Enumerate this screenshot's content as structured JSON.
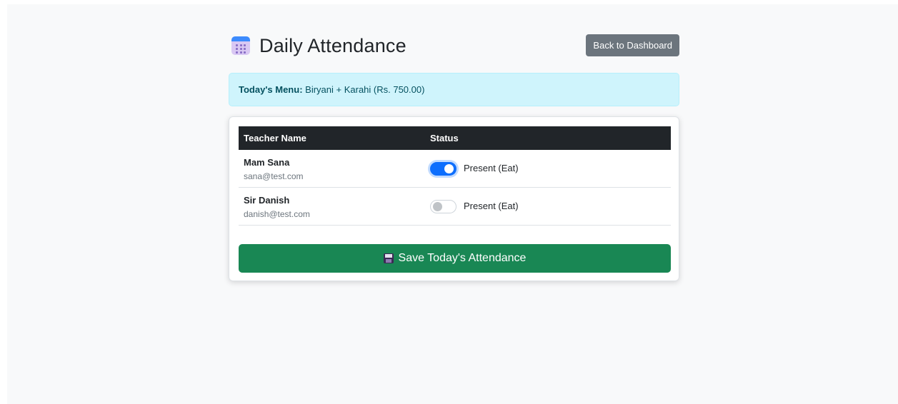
{
  "page": {
    "title": "Daily Attendance",
    "title_icon": "calendar-icon"
  },
  "header": {
    "back_label": "Back to Dashboard"
  },
  "menu": {
    "label": "Today's Menu:",
    "value": "Biryani + Karahi (Rs. 750.00)"
  },
  "table": {
    "headers": [
      "Teacher Name",
      "Status"
    ],
    "rows": [
      {
        "name": "Mam Sana",
        "email": "sana@test.com",
        "status_label": "Present (Eat)",
        "present": true
      },
      {
        "name": "Sir Danish",
        "email": "danish@test.com",
        "status_label": "Present (Eat)",
        "present": false
      }
    ]
  },
  "save": {
    "label": "Save Today's Attendance",
    "icon": "floppy-disk-icon"
  },
  "colors": {
    "primary": "#0d6efd",
    "success": "#198754",
    "secondary": "#6c757d",
    "info_bg": "#cff4fc",
    "dark": "#212529"
  }
}
